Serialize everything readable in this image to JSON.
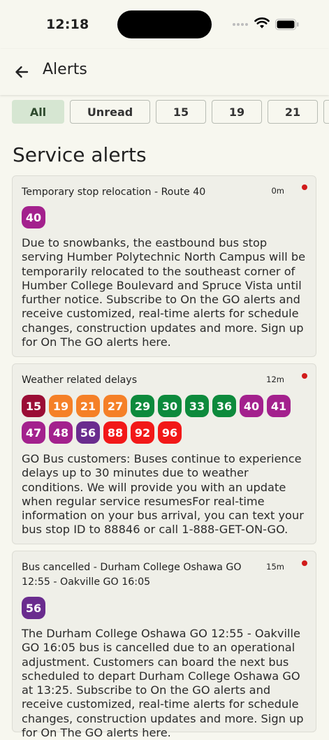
{
  "status": {
    "time": "12:18"
  },
  "header": {
    "title": "Alerts"
  },
  "filters": [
    "All",
    "Unread",
    "15",
    "19",
    "21"
  ],
  "section_title": "Service alerts",
  "alerts": [
    {
      "title": "Temporary stop relocation - Route 40",
      "time": "0m",
      "routes": [
        {
          "label": "40",
          "color": "#a3218d"
        }
      ],
      "body": "Due to snowbanks, the eastbound bus stop serving Humber Polytechnic North Campus will be temporarily relocated to the southeast corner of Humber College Boulevard and Spruce Vista until further notice. Subscribe to On the GO alerts and receive customized, real-time alerts for schedule changes, construction updates and more. Sign up for On The GO alerts here."
    },
    {
      "title": "Weather related delays",
      "time": "12m",
      "routes": [
        {
          "label": "15",
          "color": "#9a0d35"
        },
        {
          "label": "19",
          "color": "#f58027"
        },
        {
          "label": "21",
          "color": "#f58027"
        },
        {
          "label": "27",
          "color": "#f58027"
        },
        {
          "label": "29",
          "color": "#0d8a3c"
        },
        {
          "label": "30",
          "color": "#0d8a3c"
        },
        {
          "label": "33",
          "color": "#0d8a3c"
        },
        {
          "label": "36",
          "color": "#0d8a3c"
        },
        {
          "label": "40",
          "color": "#a3218d"
        },
        {
          "label": "41",
          "color": "#a3218d"
        },
        {
          "label": "47",
          "color": "#a3218d"
        },
        {
          "label": "48",
          "color": "#a3218d"
        },
        {
          "label": "56",
          "color": "#6a2c8e"
        },
        {
          "label": "88",
          "color": "#f21818"
        },
        {
          "label": "92",
          "color": "#f21818"
        },
        {
          "label": "96",
          "color": "#f21818"
        }
      ],
      "body": "GO Bus customers: Buses continue to experience delays up to 30 minutes due to weather conditions. We will provide you with an update when regular service resumesFor real-time information on your bus arrival, you can text your bus stop ID to 88846 or call 1-888-GET-ON-GO."
    },
    {
      "title": "Bus cancelled - Durham College Oshawa GO 12:55 - Oakville GO 16:05",
      "time": "15m",
      "routes": [
        {
          "label": "56",
          "color": "#6a2c8e"
        }
      ],
      "body": "The Durham College Oshawa GO 12:55 - Oakville GO 16:05 bus is cancelled due to an operational adjustment. Customers can board the next bus scheduled to depart Durham College Oshawa GO at 13:25. Subscribe to On the GO alerts and receive customized, real-time alerts for schedule changes, construction updates and more. Sign up for On The GO alerts here."
    }
  ]
}
